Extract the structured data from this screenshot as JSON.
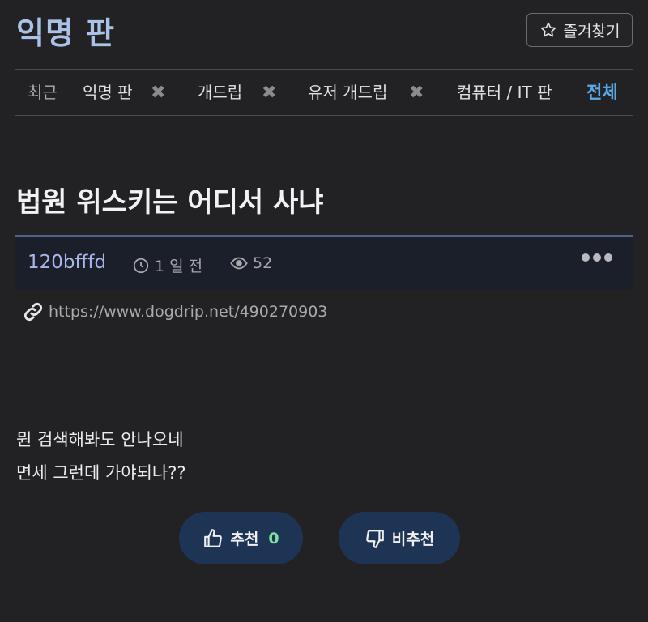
{
  "board": {
    "title": "익명 판",
    "favorite_label": "즐겨찾기"
  },
  "recent": {
    "label": "최근",
    "items": [
      {
        "label": "익명 판",
        "close": "✖"
      },
      {
        "label": "개드립",
        "close": "✖"
      },
      {
        "label": "유저 개드립",
        "close": "✖"
      },
      {
        "label": "컴퓨터 / IT 판"
      }
    ],
    "all_label": "전체"
  },
  "post": {
    "title": "법원 위스키는 어디서 사냐",
    "author": "120bfffd",
    "time": "1 일 전",
    "views": "52",
    "link": "https://www.dogdrip.net/490270903",
    "body_lines": [
      "뭔 검색해봐도 안나오네",
      "면세 그런데 가야되나??"
    ]
  },
  "votes": {
    "up_label": "추천",
    "up_count": "0",
    "down_label": "비추천"
  },
  "colors": {
    "background": "#222224",
    "board_title": "#a9c2e6",
    "accent_link": "#5aa9e6",
    "author": "#a9b6ea",
    "vote_button": "#1d3454",
    "vote_count": "#7fe0a0"
  }
}
